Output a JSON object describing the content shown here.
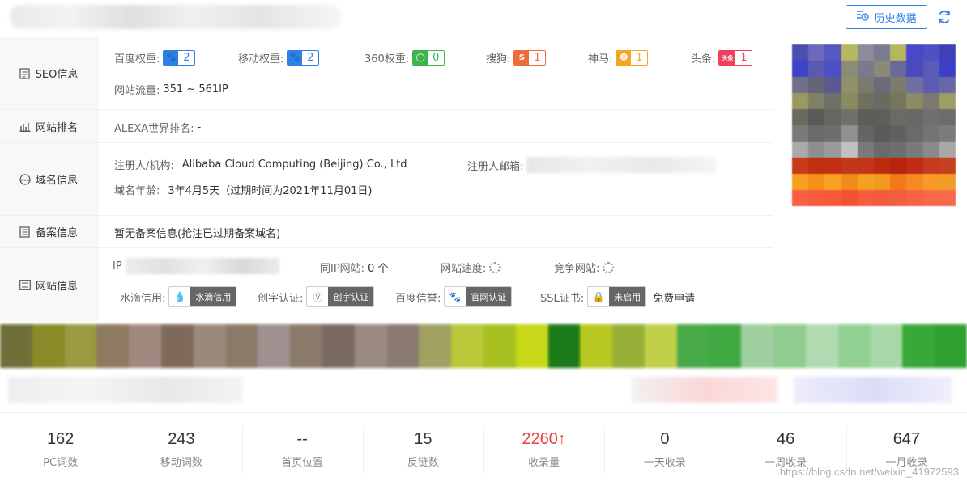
{
  "header": {
    "history_label": "历史数据"
  },
  "seo": {
    "label": "SEO信息",
    "weights": [
      {
        "label": "百度权重:",
        "value": "2",
        "color": "#2f7fe6",
        "icon": "baidu-paw-icon"
      },
      {
        "label": "移动权重:",
        "value": "2",
        "color": "#2f7fe6",
        "icon": "baidu-paw-icon"
      },
      {
        "label": "360权重:",
        "value": "0",
        "color": "#3bb54a",
        "icon": "360-ring-icon"
      },
      {
        "label": "搜狗:",
        "value": "1",
        "color": "#ee6a3a",
        "icon": "sogou-icon"
      },
      {
        "label": "神马:",
        "value": "1",
        "color": "#f5a623",
        "icon": "shenma-icon"
      },
      {
        "label": "头条:",
        "value": "1",
        "color": "#f0405d",
        "icon": "toutiao-icon",
        "icon_text": "头条"
      }
    ],
    "traffic_label": "网站流量:",
    "traffic_value": "351 ~ 561IP"
  },
  "rank": {
    "label": "网站排名",
    "alexa_label": "ALEXA世界排名:",
    "alexa_value": "-"
  },
  "domain": {
    "label": "域名信息",
    "registrant_label": "注册人/机构:",
    "registrant_value": "Alibaba Cloud Computing (Beijing) Co., Ltd",
    "email_label": "注册人邮箱:",
    "age_label": "域名年龄:",
    "age_value": "3年4月5天（过期时间为2021年11月01日)"
  },
  "beian": {
    "label": "备案信息",
    "text": "暂无备案信息(抢注已过期备案域名)"
  },
  "site": {
    "label": "网站信息",
    "ip_label": "IP",
    "same_ip_label": "同IP网站:",
    "same_ip_value": "0 个",
    "speed_label": "网站速度:",
    "competitor_label": "竞争网站:",
    "certs": [
      {
        "label": "水滴信用:",
        "badge": "水滴信用",
        "icon": "water-drop-icon"
      },
      {
        "label": "创宇认证:",
        "badge": "创宇认证",
        "icon": "v-shield-icon"
      },
      {
        "label": "百度信誉:",
        "badge": "官网认证",
        "icon": "baidu-paw-icon"
      },
      {
        "label": "SSL证书:",
        "badge": "未启用",
        "icon": "ssl-lock-icon"
      }
    ],
    "free_apply": "免费申请"
  },
  "stats": [
    {
      "value": "162",
      "label": "PC词数"
    },
    {
      "value": "243",
      "label": "移动词数"
    },
    {
      "value": "--",
      "label": "首页位置"
    },
    {
      "value": "15",
      "label": "反链数"
    },
    {
      "value": "2260",
      "label": "收录量",
      "highlight": true,
      "arrow": "↑"
    },
    {
      "value": "0",
      "label": "一天收录"
    },
    {
      "value": "46",
      "label": "一周收录"
    },
    {
      "value": "647",
      "label": "一月收录"
    }
  ],
  "watermark": "https://blog.csdn.net/weixin_41972593"
}
